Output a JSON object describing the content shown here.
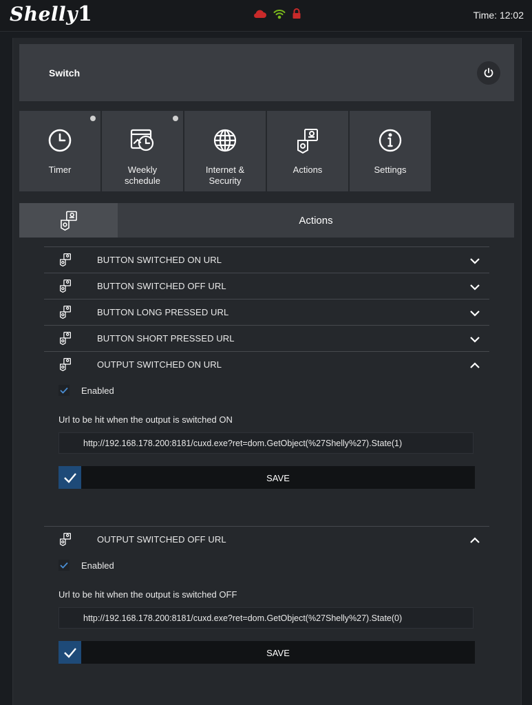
{
  "header": {
    "logo": "Shelly",
    "logo_model": "1",
    "time_label": "Time: 12:02",
    "icons": [
      "cloud-icon",
      "wifi-icon",
      "lock-icon"
    ],
    "colors": {
      "cloud": "#c92a2a",
      "wifi": "#7ab81c",
      "lock": "#c92a2a"
    }
  },
  "switch_card": {
    "title": "Switch",
    "icon": "power-icon"
  },
  "tiles": [
    {
      "label": "Timer",
      "icon": "clock-icon",
      "dot": true
    },
    {
      "label": "Weekly\nschedule",
      "icon": "schedule-icon",
      "dot": true
    },
    {
      "label": "Internet &\nSecurity",
      "icon": "globe-icon",
      "dot": false
    },
    {
      "label": "Actions",
      "icon": "actions-icon",
      "dot": false
    },
    {
      "label": "Settings",
      "icon": "info-icon",
      "dot": false
    }
  ],
  "section": {
    "title": "Actions",
    "icon": "actions-icon"
  },
  "actions": [
    {
      "label": "BUTTON SWITCHED ON URL",
      "expanded": false
    },
    {
      "label": "BUTTON SWITCHED OFF URL",
      "expanded": false
    },
    {
      "label": "BUTTON LONG PRESSED URL",
      "expanded": false
    },
    {
      "label": "BUTTON SHORT PRESSED URL",
      "expanded": false
    },
    {
      "label": "OUTPUT SWITCHED ON URL",
      "expanded": true,
      "enabled_label": "Enabled",
      "enabled": true,
      "url_caption": "Url to be hit when the output is switched ON",
      "url_value": "http://192.168.178.200:8181/cuxd.exe?ret=dom.GetObject(%27Shelly%27).State(1)",
      "save_label": "SAVE"
    },
    {
      "label": "OUTPUT SWITCHED OFF URL",
      "expanded": true,
      "enabled_label": "Enabled",
      "enabled": true,
      "url_caption": "Url to be hit when the output is switched OFF",
      "url_value": "http://192.168.178.200:8181/cuxd.exe?ret=dom.GetObject(%27Shelly%27).State(0)",
      "save_label": "SAVE"
    }
  ],
  "accent_color": "#1e4a78"
}
